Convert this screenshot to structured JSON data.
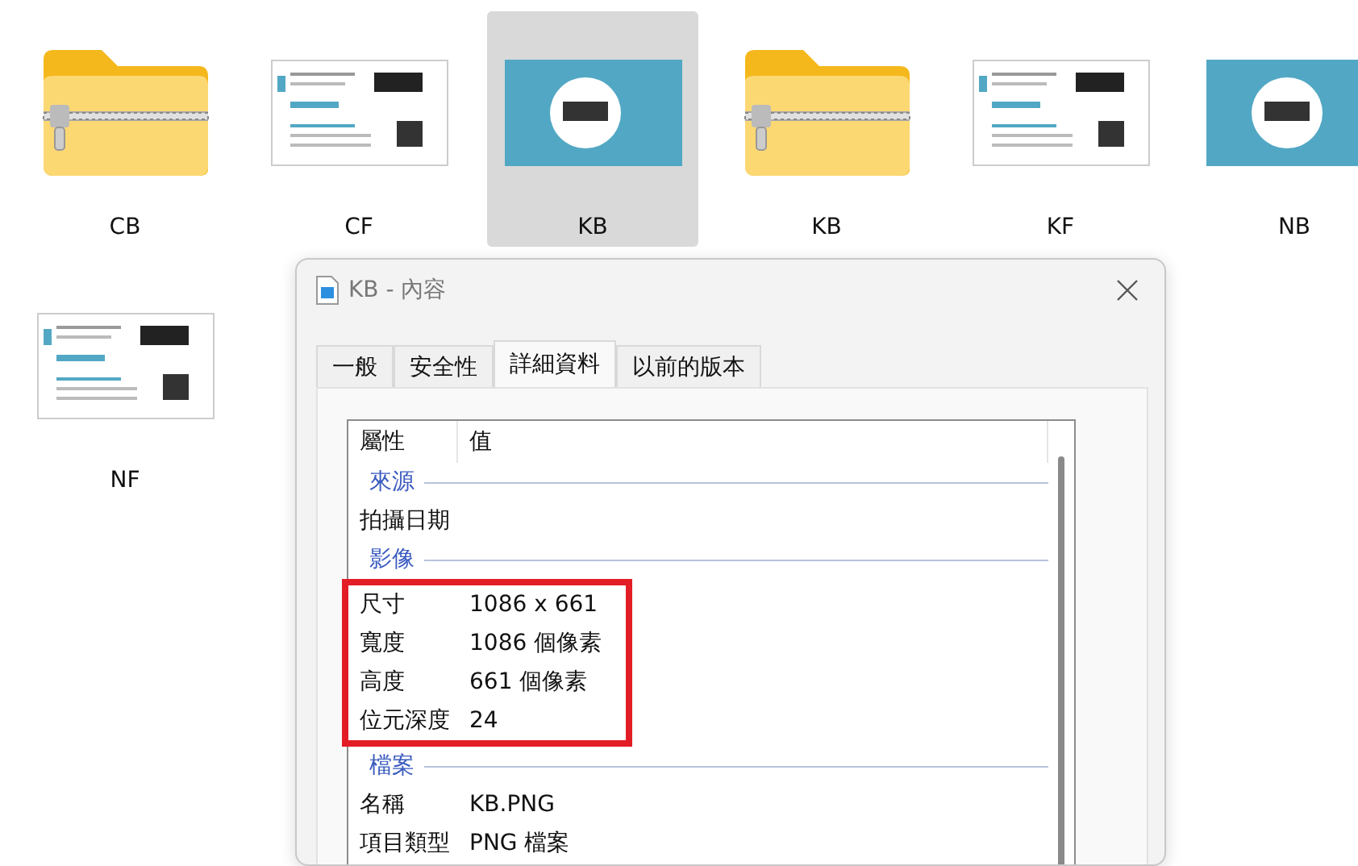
{
  "desktop": {
    "items": [
      {
        "kind": "zip-folder",
        "label": "CB",
        "selected": false
      },
      {
        "kind": "card-front",
        "label": "CF",
        "selected": false
      },
      {
        "kind": "card-back",
        "label": "KB",
        "selected": true
      },
      {
        "kind": "zip-folder",
        "label": "KB",
        "selected": false
      },
      {
        "kind": "card-front",
        "label": "KF",
        "selected": false
      },
      {
        "kind": "card-back",
        "label": "NB",
        "selected": false
      },
      {
        "kind": "card-front",
        "label": "NF",
        "selected": false
      }
    ]
  },
  "dialog": {
    "title": "KB - 內容",
    "tabs": [
      {
        "label": "一般",
        "selected": false
      },
      {
        "label": "安全性",
        "selected": false
      },
      {
        "label": "詳細資料",
        "selected": true
      },
      {
        "label": "以前的版本",
        "selected": false
      }
    ],
    "columns": [
      "屬性",
      "值"
    ],
    "groups": [
      {
        "title": "來源",
        "highlighted": false,
        "rows": [
          {
            "name": "拍攝日期"
          }
        ]
      },
      {
        "title": "影像",
        "highlighted": true,
        "rows": [
          {
            "name": "尺寸",
            "value": "1086 x 661"
          },
          {
            "name": "寬度",
            "value": "1086 個像素"
          },
          {
            "name": "高度",
            "value": "661 個像素"
          },
          {
            "name": "位元深度",
            "value": "24"
          }
        ]
      },
      {
        "title": "檔案",
        "highlighted": false,
        "rows": [
          {
            "name": "名稱",
            "value": "KB.PNG"
          },
          {
            "name": "項目類型",
            "value": "PNG 檔案"
          }
        ]
      }
    ]
  }
}
